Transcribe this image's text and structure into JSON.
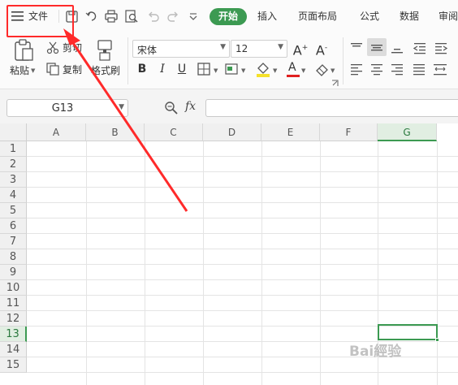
{
  "menubar": {
    "menu_icon": "hamburger-menu-icon",
    "file_label": "文件",
    "quick_access": [
      "save-icon",
      "undo-history-icon",
      "print-icon",
      "print-preview-icon",
      "undo-icon",
      "redo-icon",
      "customize-dropdown-icon"
    ],
    "tabs": [
      {
        "label": "开始",
        "active": true
      },
      {
        "label": "插入"
      },
      {
        "label": "页面布局"
      },
      {
        "label": "公式"
      },
      {
        "label": "数据"
      },
      {
        "label": "审阅"
      }
    ]
  },
  "ribbon": {
    "paste_label": "粘贴",
    "cut_label": "剪切",
    "copy_label": "复制",
    "format_painter_label": "格式刷",
    "font_name": "宋体",
    "font_size": "12",
    "bold_label": "B",
    "italic_label": "I",
    "underline_label": "U",
    "font_color_label": "A"
  },
  "formula_bar": {
    "name_box": "G13",
    "fx_label": "fx",
    "formula_value": ""
  },
  "sheet": {
    "columns": [
      "A",
      "B",
      "C",
      "D",
      "E",
      "F",
      "G"
    ],
    "selected_column": "G",
    "rows": [
      "1",
      "2",
      "3",
      "4",
      "5",
      "6",
      "7",
      "8",
      "9",
      "10",
      "11",
      "12",
      "13",
      "14",
      "15"
    ],
    "selected_row": "13",
    "active_cell": "G13"
  },
  "colors": {
    "accent": "#3c9a52",
    "annotation": "#ff2a2a"
  },
  "watermark": "Bai經验"
}
